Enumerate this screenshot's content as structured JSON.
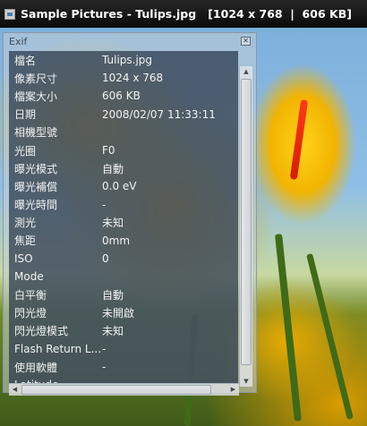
{
  "window": {
    "title": "Sample Pictures - Tulips.jpg   [1024 x 768  |  606 KB]"
  },
  "exif": {
    "header": "Exif",
    "rows": [
      {
        "key": "檔名",
        "value": "Tulips.jpg"
      },
      {
        "key": "像素尺寸",
        "value": "1024 x 768"
      },
      {
        "key": "檔案大小",
        "value": "606 KB"
      },
      {
        "key": "日期",
        "value": "2008/02/07 11:33:11"
      },
      {
        "key": "相機型號",
        "value": ""
      },
      {
        "key": "光圈",
        "value": "F0"
      },
      {
        "key": "曝光模式",
        "value": "自動"
      },
      {
        "key": "曝光補償",
        "value": "0.0 eV"
      },
      {
        "key": "曝光時間",
        "value": "-"
      },
      {
        "key": "測光",
        "value": "未知"
      },
      {
        "key": "焦距",
        "value": "0mm"
      },
      {
        "key": "ISO",
        "value": "0"
      },
      {
        "key": "Mode",
        "value": ""
      },
      {
        "key": "白平衡",
        "value": "自動"
      },
      {
        "key": "閃光燈",
        "value": "未開啟"
      },
      {
        "key": "閃光燈模式",
        "value": "未知"
      },
      {
        "key": "Flash Return L...",
        "value": "-"
      },
      {
        "key": "使用軟體",
        "value": "-"
      },
      {
        "key": "Latitude",
        "value": "-"
      }
    ]
  },
  "icons": {
    "app": "window-icon",
    "close": "close-icon",
    "scroll_up": "scroll-up-arrow-icon",
    "scroll_down": "scroll-down-arrow-icon",
    "scroll_left": "scroll-left-arrow-icon",
    "scroll_right": "scroll-right-arrow-icon"
  },
  "colors": {
    "titlebar": "#0b0b0b",
    "panel_bg": "#283648",
    "text": "#f2f2f2"
  }
}
